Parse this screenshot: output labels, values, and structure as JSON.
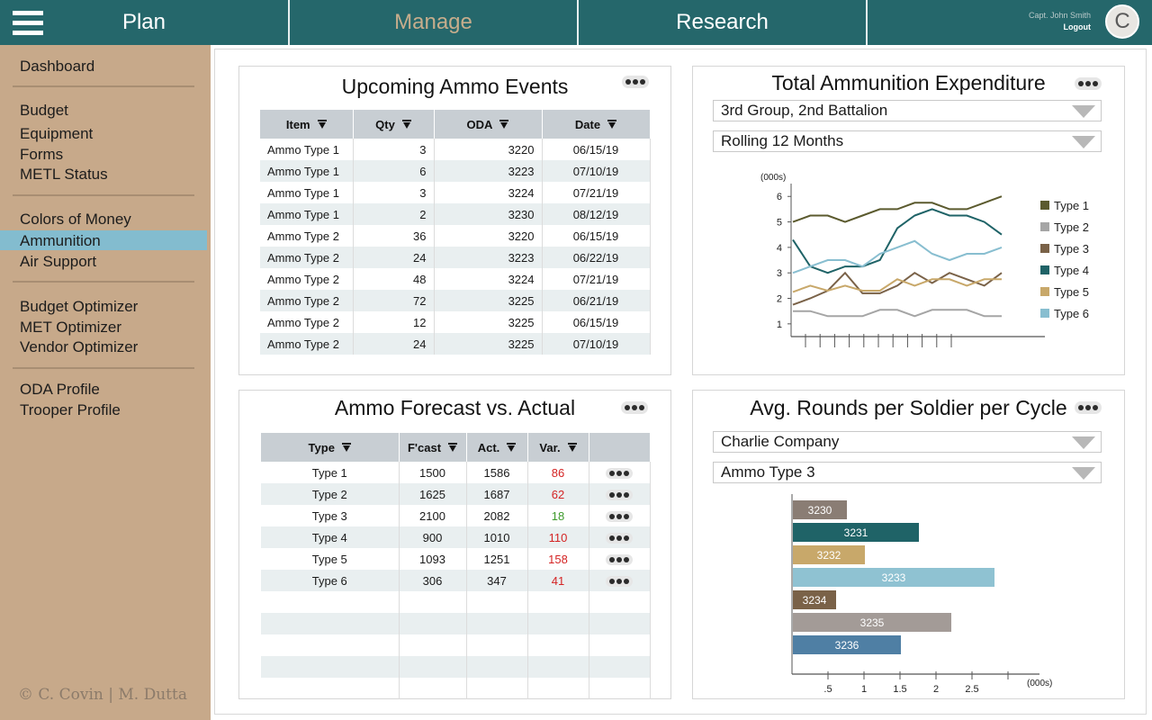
{
  "nav": {
    "tabs": [
      {
        "label": "Plan"
      },
      {
        "label": "Manage"
      },
      {
        "label": "Research"
      }
    ],
    "user_name": "Capt. John Smith",
    "logout": "Logout",
    "avatar_initial": "C"
  },
  "sidebar": {
    "items": [
      {
        "label": "Dashboard"
      },
      {
        "label": "Budget"
      },
      {
        "label": "Equipment"
      },
      {
        "label": "Forms"
      },
      {
        "label": "METL Status"
      },
      {
        "label": "Colors of Money"
      },
      {
        "label": "Ammunition",
        "active": true
      },
      {
        "label": "Air Support"
      },
      {
        "label": "Budget Optimizer"
      },
      {
        "label": "MET Optimizer"
      },
      {
        "label": "Vendor Optimizer"
      },
      {
        "label": "ODA Profile"
      },
      {
        "label": "Trooper Profile"
      }
    ],
    "copyright": "© C. Covin | M. Dutta"
  },
  "upcoming": {
    "title": "Upcoming Ammo Events",
    "columns": [
      "Item",
      "Qty",
      "ODA",
      "Date"
    ],
    "rows": [
      [
        "Ammo Type 1",
        "3",
        "3220",
        "06/15/19"
      ],
      [
        "Ammo Type 1",
        "6",
        "3223",
        "07/10/19"
      ],
      [
        "Ammo Type 1",
        "3",
        "3224",
        "07/21/19"
      ],
      [
        "Ammo Type 1",
        "2",
        "3230",
        "08/12/19"
      ],
      [
        "Ammo Type 2",
        "36",
        "3220",
        "06/15/19"
      ],
      [
        "Ammo Type 2",
        "24",
        "3223",
        "06/22/19"
      ],
      [
        "Ammo Type 2",
        "48",
        "3224",
        "07/21/19"
      ],
      [
        "Ammo Type 2",
        "72",
        "3225",
        "06/21/19"
      ],
      [
        "Ammo Type 2",
        "12",
        "3225",
        "06/15/19"
      ],
      [
        "Ammo Type 2",
        "24",
        "3225",
        "07/10/19"
      ]
    ]
  },
  "forecast": {
    "title": "Ammo Forecast vs. Actual",
    "columns": [
      "Type",
      "F'cast",
      "Act.",
      "Var."
    ],
    "rows": [
      {
        "type": "Type 1",
        "fcast": "1500",
        "act": "1586",
        "var": "86",
        "status": "over"
      },
      {
        "type": "Type 2",
        "fcast": "1625",
        "act": "1687",
        "var": "62",
        "status": "over"
      },
      {
        "type": "Type 3",
        "fcast": "2100",
        "act": "2082",
        "var": "18",
        "status": "under"
      },
      {
        "type": "Type 4",
        "fcast": "900",
        "act": "1010",
        "var": "110",
        "status": "over"
      },
      {
        "type": "Type 5",
        "fcast": "1093",
        "act": "1251",
        "var": "158",
        "status": "over"
      },
      {
        "type": "Type 6",
        "fcast": "306",
        "act": "347",
        "var": "41",
        "status": "over"
      }
    ],
    "empty_rows": 5
  },
  "expenditure": {
    "title": "Total Ammunition Expenditure",
    "filter_unit": "3rd Group, 2nd Battalion",
    "filter_period": "Rolling 12 Months"
  },
  "rounds": {
    "title": "Avg. Rounds per Soldier per Cycle",
    "filter_company": "Charlie Company",
    "filter_ammo": "Ammo Type 3"
  },
  "chart_data": [
    {
      "type": "line",
      "title": "Total Ammunition Expenditure",
      "ylabel": "(000s)",
      "ylim": [
        1,
        6
      ],
      "yticks": [
        1,
        2,
        3,
        4,
        5,
        6
      ],
      "x": [
        0,
        1,
        2,
        3,
        4,
        5,
        6,
        7,
        8,
        9,
        10,
        11
      ],
      "legend_position": "right",
      "grid": false,
      "series": [
        {
          "name": "Type 1",
          "color": "#5b5a2e",
          "values": [
            5.0,
            5.25,
            5.25,
            5.0,
            5.25,
            5.5,
            5.5,
            5.75,
            5.75,
            5.5,
            5.5,
            5.75,
            6.0
          ]
        },
        {
          "name": "Type 2",
          "color": "#a5a5a5",
          "values": [
            1.5,
            1.5,
            1.3,
            1.3,
            1.3,
            1.55,
            1.55,
            1.3,
            1.55,
            1.55,
            1.55,
            1.3,
            1.3
          ]
        },
        {
          "name": "Type 3",
          "color": "#7a6248",
          "values": [
            1.75,
            2.0,
            2.3,
            3.0,
            2.2,
            2.2,
            2.5,
            3.0,
            2.6,
            3.0,
            2.75,
            2.5,
            3.0
          ]
        },
        {
          "name": "Type 4",
          "color": "#1f6367",
          "values": [
            4.3,
            3.25,
            3.0,
            3.25,
            3.25,
            3.5,
            4.75,
            5.25,
            5.5,
            5.25,
            5.25,
            5.0,
            4.5
          ]
        },
        {
          "name": "Type 5",
          "color": "#c8a86a",
          "values": [
            2.25,
            2.5,
            2.3,
            2.5,
            2.3,
            2.3,
            2.75,
            2.5,
            2.75,
            2.75,
            2.5,
            2.75,
            2.75
          ]
        },
        {
          "name": "Type 6",
          "color": "#88bed0",
          "values": [
            3.0,
            3.25,
            3.5,
            3.5,
            3.25,
            3.75,
            4.0,
            4.25,
            3.75,
            3.5,
            3.75,
            3.75,
            4.0
          ]
        }
      ]
    },
    {
      "type": "bar",
      "title": "Avg. Rounds per Soldier per Cycle",
      "orientation": "horizontal",
      "xlabel": "(000s)",
      "xticks": [
        ".5",
        "1",
        "1.5",
        "2",
        "2.5"
      ],
      "xlim": [
        0,
        3.0
      ],
      "categories": [
        "3230",
        "3231",
        "3232",
        "3233",
        "3234",
        "3235",
        "3236"
      ],
      "values": [
        0.75,
        1.75,
        1.0,
        2.8,
        0.6,
        2.2,
        1.5
      ],
      "colors": [
        "#8a7d74",
        "#1f6367",
        "#c8a86a",
        "#8fc2d2",
        "#7a6248",
        "#a39b97",
        "#4f7fa4"
      ]
    }
  ]
}
